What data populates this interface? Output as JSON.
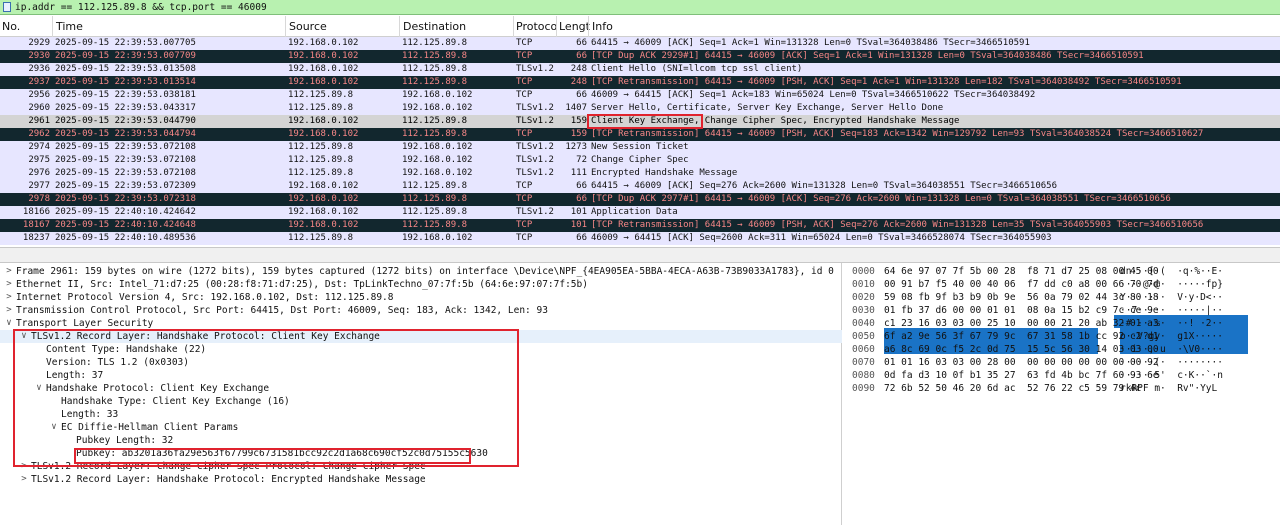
{
  "filter": {
    "text": "ip.addr == 112.125.89.8 && tcp.port == 46009"
  },
  "columns": {
    "no": "No.",
    "time": "Time",
    "source": "Source",
    "destination": "Destination",
    "protocol": "Protoco",
    "length": "Lengt",
    "info": "Info"
  },
  "packets": [
    {
      "no": "2929",
      "time": "2025-09-15 22:39:53.007705",
      "src": "192.168.0.102",
      "dst": "112.125.89.8",
      "proto": "TCP",
      "len": "66",
      "info": "64415 → 46009 [ACK] Seq=1 Ack=1 Win=131328 Len=0 TSval=364038486 TSecr=3466510591",
      "style": "normal"
    },
    {
      "no": "2930",
      "time": "2025-09-15 22:39:53.007709",
      "src": "192.168.0.102",
      "dst": "112.125.89.8",
      "proto": "TCP",
      "len": "66",
      "info": "[TCP Dup ACK 2929#1] 64415 → 46009 [ACK] Seq=1 Ack=1 Win=131328 Len=0 TSval=364038486 TSecr=3466510591",
      "style": "dark"
    },
    {
      "no": "2936",
      "time": "2025-09-15 22:39:53.013508",
      "src": "192.168.0.102",
      "dst": "112.125.89.8",
      "proto": "TLSv1.2",
      "len": "248",
      "info": "Client Hello (SNI=llcom tcp ssl client)",
      "style": "normal"
    },
    {
      "no": "2937",
      "time": "2025-09-15 22:39:53.013514",
      "src": "192.168.0.102",
      "dst": "112.125.89.8",
      "proto": "TCP",
      "len": "248",
      "info": "[TCP Retransmission] 64415 → 46009 [PSH, ACK] Seq=1 Ack=1 Win=131328 Len=182 TSval=364038492 TSecr=3466510591",
      "style": "dark"
    },
    {
      "no": "2956",
      "time": "2025-09-15 22:39:53.038181",
      "src": "112.125.89.8",
      "dst": "192.168.0.102",
      "proto": "TCP",
      "len": "66",
      "info": "46009 → 64415 [ACK] Seq=1 Ack=183 Win=65024 Len=0 TSval=3466510622 TSecr=364038492",
      "style": "normal"
    },
    {
      "no": "2960",
      "time": "2025-09-15 22:39:53.043317",
      "src": "112.125.89.8",
      "dst": "192.168.0.102",
      "proto": "TLSv1.2",
      "len": "1407",
      "info": "Server Hello, Certificate, Server Key Exchange, Server Hello Done",
      "style": "normal"
    },
    {
      "no": "2961",
      "time": "2025-09-15 22:39:53.044790",
      "src": "192.168.0.102",
      "dst": "112.125.89.8",
      "proto": "TLSv1.2",
      "len": "159",
      "info": "Client Key Exchange, Change Cipher Spec, Encrypted Handshake Message",
      "style": "sel"
    },
    {
      "no": "2962",
      "time": "2025-09-15 22:39:53.044794",
      "src": "192.168.0.102",
      "dst": "112.125.89.8",
      "proto": "TCP",
      "len": "159",
      "info": "[TCP Retransmission] 64415 → 46009 [PSH, ACK] Seq=183 Ack=1342 Win=129792 Len=93 TSval=364038524 TSecr=3466510627",
      "style": "dark"
    },
    {
      "no": "2974",
      "time": "2025-09-15 22:39:53.072108",
      "src": "112.125.89.8",
      "dst": "192.168.0.102",
      "proto": "TLSv1.2",
      "len": "1273",
      "info": "New Session Ticket",
      "style": "normal"
    },
    {
      "no": "2975",
      "time": "2025-09-15 22:39:53.072108",
      "src": "112.125.89.8",
      "dst": "192.168.0.102",
      "proto": "TLSv1.2",
      "len": "72",
      "info": "Change Cipher Spec",
      "style": "normal"
    },
    {
      "no": "2976",
      "time": "2025-09-15 22:39:53.072108",
      "src": "112.125.89.8",
      "dst": "192.168.0.102",
      "proto": "TLSv1.2",
      "len": "111",
      "info": "Encrypted Handshake Message",
      "style": "normal"
    },
    {
      "no": "2977",
      "time": "2025-09-15 22:39:53.072309",
      "src": "192.168.0.102",
      "dst": "112.125.89.8",
      "proto": "TCP",
      "len": "66",
      "info": "64415 → 46009 [ACK] Seq=276 Ack=2600 Win=131328 Len=0 TSval=364038551 TSecr=3466510656",
      "style": "normal"
    },
    {
      "no": "2978",
      "time": "2025-09-15 22:39:53.072318",
      "src": "192.168.0.102",
      "dst": "112.125.89.8",
      "proto": "TCP",
      "len": "66",
      "info": "[TCP Dup ACK 2977#1] 64415 → 46009 [ACK] Seq=276 Ack=2600 Win=131328 Len=0 TSval=364038551 TSecr=3466510656",
      "style": "dark"
    },
    {
      "no": "18166",
      "time": "2025-09-15 22:40:10.424642",
      "src": "192.168.0.102",
      "dst": "112.125.89.8",
      "proto": "TLSv1.2",
      "len": "101",
      "info": "Application Data",
      "style": "normal"
    },
    {
      "no": "18167",
      "time": "2025-09-15 22:40:10.424648",
      "src": "192.168.0.102",
      "dst": "112.125.89.8",
      "proto": "TCP",
      "len": "101",
      "info": "[TCP Retransmission] 64415 → 46009 [PSH, ACK] Seq=276 Ack=2600 Win=131328 Len=35 TSval=364055903 TSecr=3466510656",
      "style": "dark"
    },
    {
      "no": "18237",
      "time": "2025-09-15 22:40:10.489536",
      "src": "112.125.89.8",
      "dst": "192.168.0.102",
      "proto": "TCP",
      "len": "66",
      "info": "46009 → 64415 [ACK] Seq=2600 Ack=311 Win=65024 Len=0 TSval=3466528074 TSecr=364055903",
      "style": "normal"
    }
  ],
  "details": [
    {
      "indent": 0,
      "arrow": ">",
      "text": "Frame 2961: 159 bytes on wire (1272 bits), 159 bytes captured (1272 bits) on interface \\Device\\NPF_{4EA905EA-5BBA-4ECA-A63B-73B9033A1783}, id 0"
    },
    {
      "indent": 0,
      "arrow": ">",
      "text": "Ethernet II, Src: Intel_71:d7:25 (00:28:f8:71:d7:25), Dst: TpLinkTechno_07:7f:5b (64:6e:97:07:7f:5b)"
    },
    {
      "indent": 0,
      "arrow": ">",
      "text": "Internet Protocol Version 4, Src: 192.168.0.102, Dst: 112.125.89.8"
    },
    {
      "indent": 0,
      "arrow": ">",
      "text": "Transmission Control Protocol, Src Port: 64415, Dst Port: 46009, Seq: 183, Ack: 1342, Len: 93"
    },
    {
      "indent": 0,
      "arrow": "v",
      "text": "Transport Layer Security"
    },
    {
      "indent": 1,
      "arrow": "v",
      "text": "TLSv1.2 Record Layer: Handshake Protocol: Client Key Exchange",
      "hl": true
    },
    {
      "indent": 2,
      "arrow": "",
      "text": "Content Type: Handshake (22)"
    },
    {
      "indent": 2,
      "arrow": "",
      "text": "Version: TLS 1.2 (0x0303)"
    },
    {
      "indent": 2,
      "arrow": "",
      "text": "Length: 37"
    },
    {
      "indent": 2,
      "arrow": "v",
      "text": "Handshake Protocol: Client Key Exchange"
    },
    {
      "indent": 3,
      "arrow": "",
      "text": "Handshake Type: Client Key Exchange (16)"
    },
    {
      "indent": 3,
      "arrow": "",
      "text": "Length: 33"
    },
    {
      "indent": 3,
      "arrow": "v",
      "text": "EC Diffie-Hellman Client Params"
    },
    {
      "indent": 4,
      "arrow": "",
      "text": "Pubkey Length: 32"
    },
    {
      "indent": 4,
      "arrow": "",
      "text": "Pubkey: ab3201a36fa29e563f67799c6731581bcc92c2d1a68c690cf52c0d75155c5630"
    },
    {
      "indent": 1,
      "arrow": ">",
      "text": "TLSv1.2 Record Layer: Change Cipher Spec Protocol: Change Cipher Spec"
    },
    {
      "indent": 1,
      "arrow": ">",
      "text": "TLSv1.2 Record Layer: Handshake Protocol: Encrypted Handshake Message"
    }
  ],
  "bytes": [
    {
      "off": "0000",
      "hex": "64 6e 97 07 7f 5b 00 28  f8 71 d7 25 08 00 45 00",
      "asc": "dn···[·(  ·q·%··E·"
    },
    {
      "off": "0010",
      "hex": "00 91 b7 f5 40 00 40 06  f7 dd c0 a8 00 66 70 7d",
      "asc": "····@·@·  ·····fp}"
    },
    {
      "off": "0020",
      "hex": "59 08 fb 9f b3 b9 0b 9e  56 0a 79 02 44 3c 80 18",
      "asc": "Y·······  V·y·D<··"
    },
    {
      "off": "0030",
      "hex": "01 fb 37 d6 00 00 01 01  08 0a 15 b2 c9 7c ce 9e",
      "asc": "··7·····  ·····|··"
    },
    {
      "off": "0040",
      "hex": "c1 23 16 03 03 00 25 10  00 00 21 20 ab 32 01 a3",
      "asc": "·#····%·  ··! ·2··"
    },
    {
      "off": "0050",
      "hex": "6f a2 9e 56 3f 67 79 9c  67 31 58 1b cc 92 c2 d1",
      "asc": "o··V?gy·  g1X·····"
    },
    {
      "off": "0060",
      "hex": "a6 8c 69 0c f5 2c 0d 75  15 5c 56 30 14 03 03 00",
      "asc": "··i··,·u  ·\\V0····"
    },
    {
      "off": "0070",
      "hex": "01 01 16 03 03 00 28 00  00 00 00 00 00 00 00 92",
      "asc": "······(·  ········"
    },
    {
      "off": "0080",
      "hex": "0d fa d3 10 0f b1 35 27  63 fd 4b bc 7f 60 93 6e",
      "asc": "······5'  c·K··`·n"
    },
    {
      "off": "0090",
      "hex": "72 6b 52 50 46 20 6d ac  52 76 22 c5 59 79 4c",
      "asc": "rkRPF m·  Rv\"·YyL"
    }
  ]
}
